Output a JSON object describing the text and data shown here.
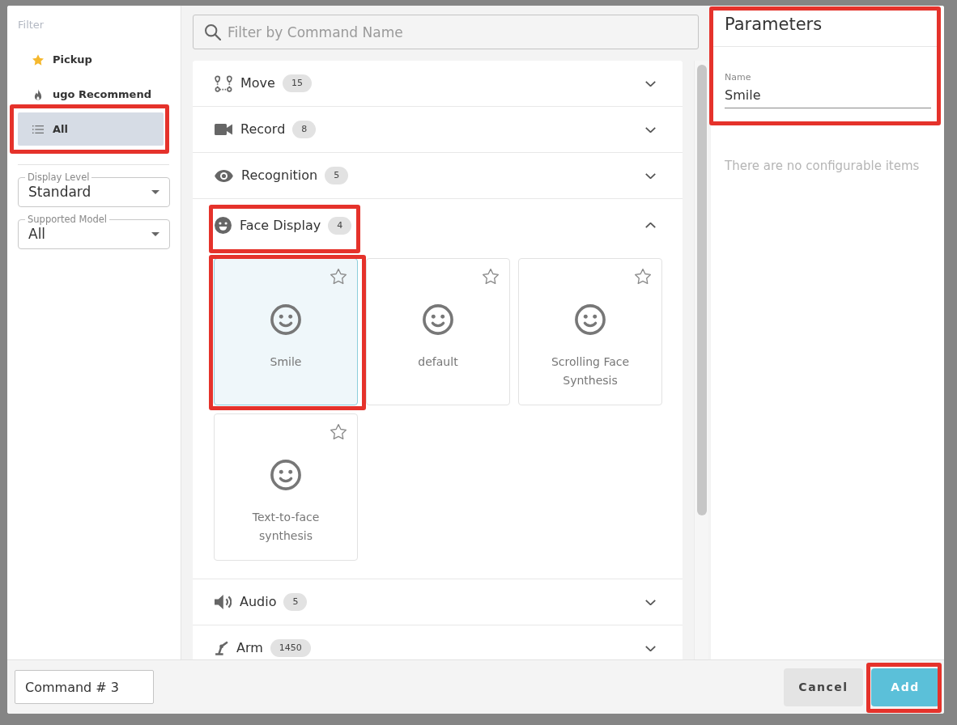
{
  "sidebar": {
    "heading": "Filter",
    "items": [
      {
        "kind": "pickup",
        "label": "Pickup",
        "selected": false,
        "highlighted": false
      },
      {
        "kind": "recommend",
        "label": "ugo Recommend",
        "selected": false,
        "highlighted": false
      },
      {
        "kind": "all",
        "label": "All",
        "selected": true,
        "highlighted": true
      }
    ],
    "selects": [
      {
        "label": "Display Level",
        "value": "Standard"
      },
      {
        "label": "Supported Model",
        "value": "All"
      }
    ]
  },
  "search": {
    "placeholder": "Filter by Command Name"
  },
  "sections": [
    {
      "kind": "move",
      "title": "Move",
      "count": "15",
      "expanded": false,
      "highlighted": false
    },
    {
      "kind": "record",
      "title": "Record",
      "count": "8",
      "expanded": false,
      "highlighted": false
    },
    {
      "kind": "recognition",
      "title": "Recognition",
      "count": "5",
      "expanded": false,
      "highlighted": false
    },
    {
      "kind": "face",
      "title": "Face Display",
      "count": "4",
      "expanded": true,
      "highlighted": true,
      "commands": [
        {
          "label": "Smile",
          "selected": true,
          "starred": false,
          "highlighted": true
        },
        {
          "label": "default",
          "selected": false,
          "starred": false,
          "highlighted": false
        },
        {
          "label": "Scrolling Face Synthesis",
          "selected": false,
          "starred": false,
          "highlighted": false
        },
        {
          "label": "Text-to-face synthesis",
          "selected": false,
          "starred": false,
          "highlighted": false
        }
      ]
    },
    {
      "kind": "audio",
      "title": "Audio",
      "count": "5",
      "expanded": false,
      "highlighted": false
    },
    {
      "kind": "arm",
      "title": "Arm",
      "count": "1450",
      "expanded": false,
      "highlighted": false
    }
  ],
  "parameters": {
    "title": "Parameters",
    "highlighted": true,
    "field": {
      "label": "Name",
      "value": "Smile"
    },
    "message": "There are no configurable items"
  },
  "footer": {
    "command_name": "Command # 3",
    "buttons": [
      {
        "kind": "cancel",
        "label": "Cancel",
        "highlighted": false
      },
      {
        "kind": "add",
        "label": "Add",
        "highlighted": true
      }
    ]
  }
}
